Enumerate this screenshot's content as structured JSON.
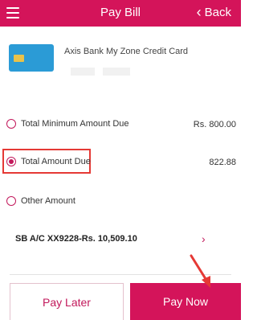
{
  "header": {
    "title": "Pay Bill",
    "back_label": "Back",
    "color": "#d4145a"
  },
  "card": {
    "name": "Axis Bank My Zone Credit Card",
    "icon": "credit-card-icon"
  },
  "options": [
    {
      "label": "Total Minimum Amount Due",
      "amount": "Rs. 800.00",
      "checked": false
    },
    {
      "label": "Total Amount Due",
      "amount": "822.88",
      "checked": true
    },
    {
      "label": "Other Amount",
      "amount": "",
      "checked": false
    }
  ],
  "account": {
    "label": "SB A/C XX9228-Rs. 10,509.10"
  },
  "buttons": {
    "pay_later": "Pay Later",
    "pay_now": "Pay Now"
  },
  "colors": {
    "accent": "#d4145a",
    "highlight": "#e53935"
  }
}
